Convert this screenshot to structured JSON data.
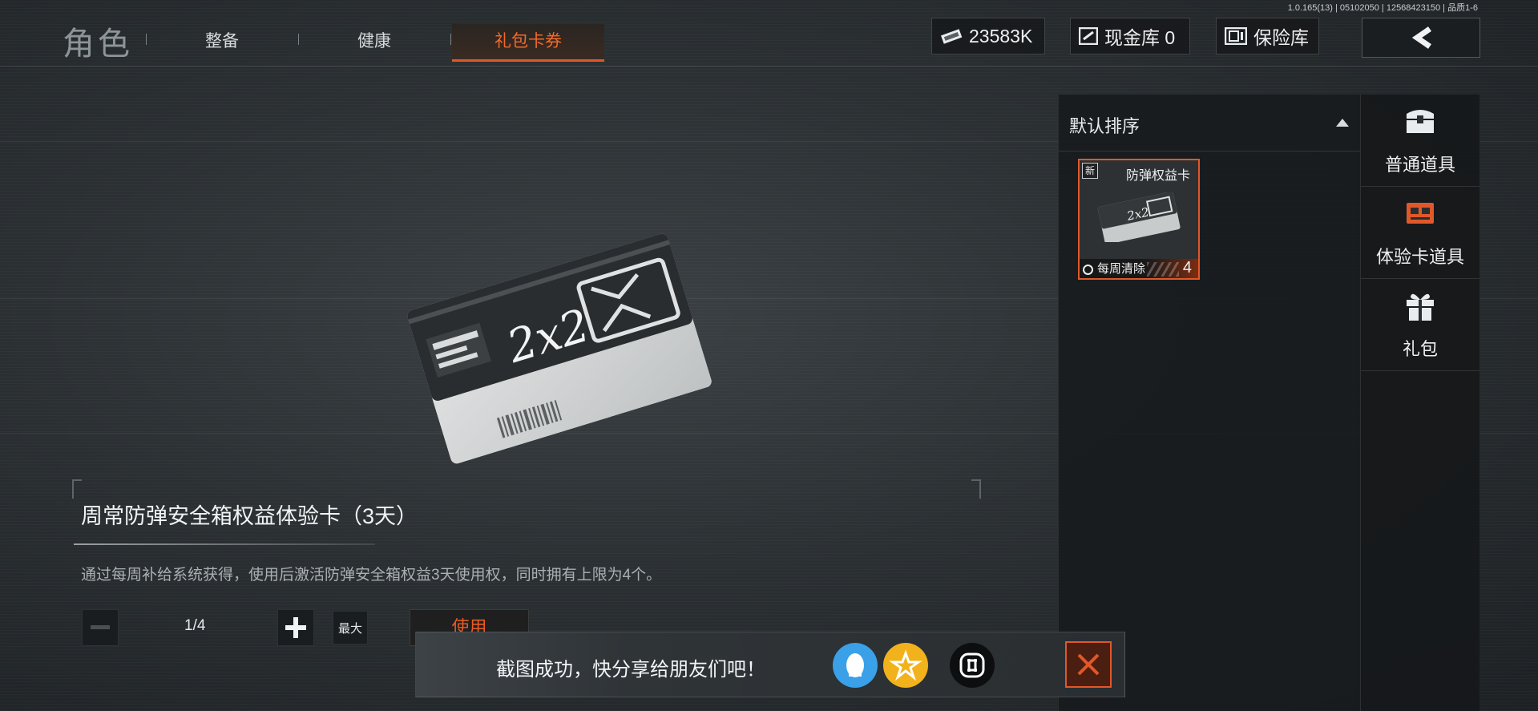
{
  "topbar": {
    "title": "角色",
    "tabs": [
      {
        "label": "整备"
      },
      {
        "label": "健康"
      },
      {
        "label": "礼包卡券",
        "active": true
      }
    ],
    "version": "1.0.165(13) | 05102050 | 12568423150 | 品质1-6",
    "currency": {
      "value": "23583K",
      "icon": "banknote-icon"
    },
    "cash_vault": {
      "label": "现金库 0",
      "icon": "vault-card-icon"
    },
    "safe": {
      "label": "保险库",
      "icon": "safe-icon"
    },
    "back_icon": "chevron-left-icon"
  },
  "item": {
    "name": "周常防弹安全箱权益体验卡（3天）",
    "description": "通过每周补给系统获得，使用后激活防弹安全箱权益3天使用权，同时拥有上限为4个。",
    "card_text": "2x2",
    "quantity": "1/4",
    "max_label": "最大",
    "use_label": "使用"
  },
  "inventory": {
    "sort_label": "默认排序",
    "slots": [
      {
        "badge": "新",
        "name": "防弹权益卡",
        "note": "每周清除",
        "count": "4"
      }
    ]
  },
  "categories": [
    {
      "label": "普通道具",
      "icon": "chest-icon",
      "active": false
    },
    {
      "label": "体验卡道具",
      "icon": "trial-card-icon",
      "active": true
    },
    {
      "label": "礼包",
      "icon": "gift-icon",
      "active": false
    }
  ],
  "toast": {
    "message": "截图成功，快分享给朋友们吧！",
    "colors": {
      "qq": "#3aa0e8",
      "qzone": "#f2b21c",
      "accent": "#e0582a"
    }
  }
}
